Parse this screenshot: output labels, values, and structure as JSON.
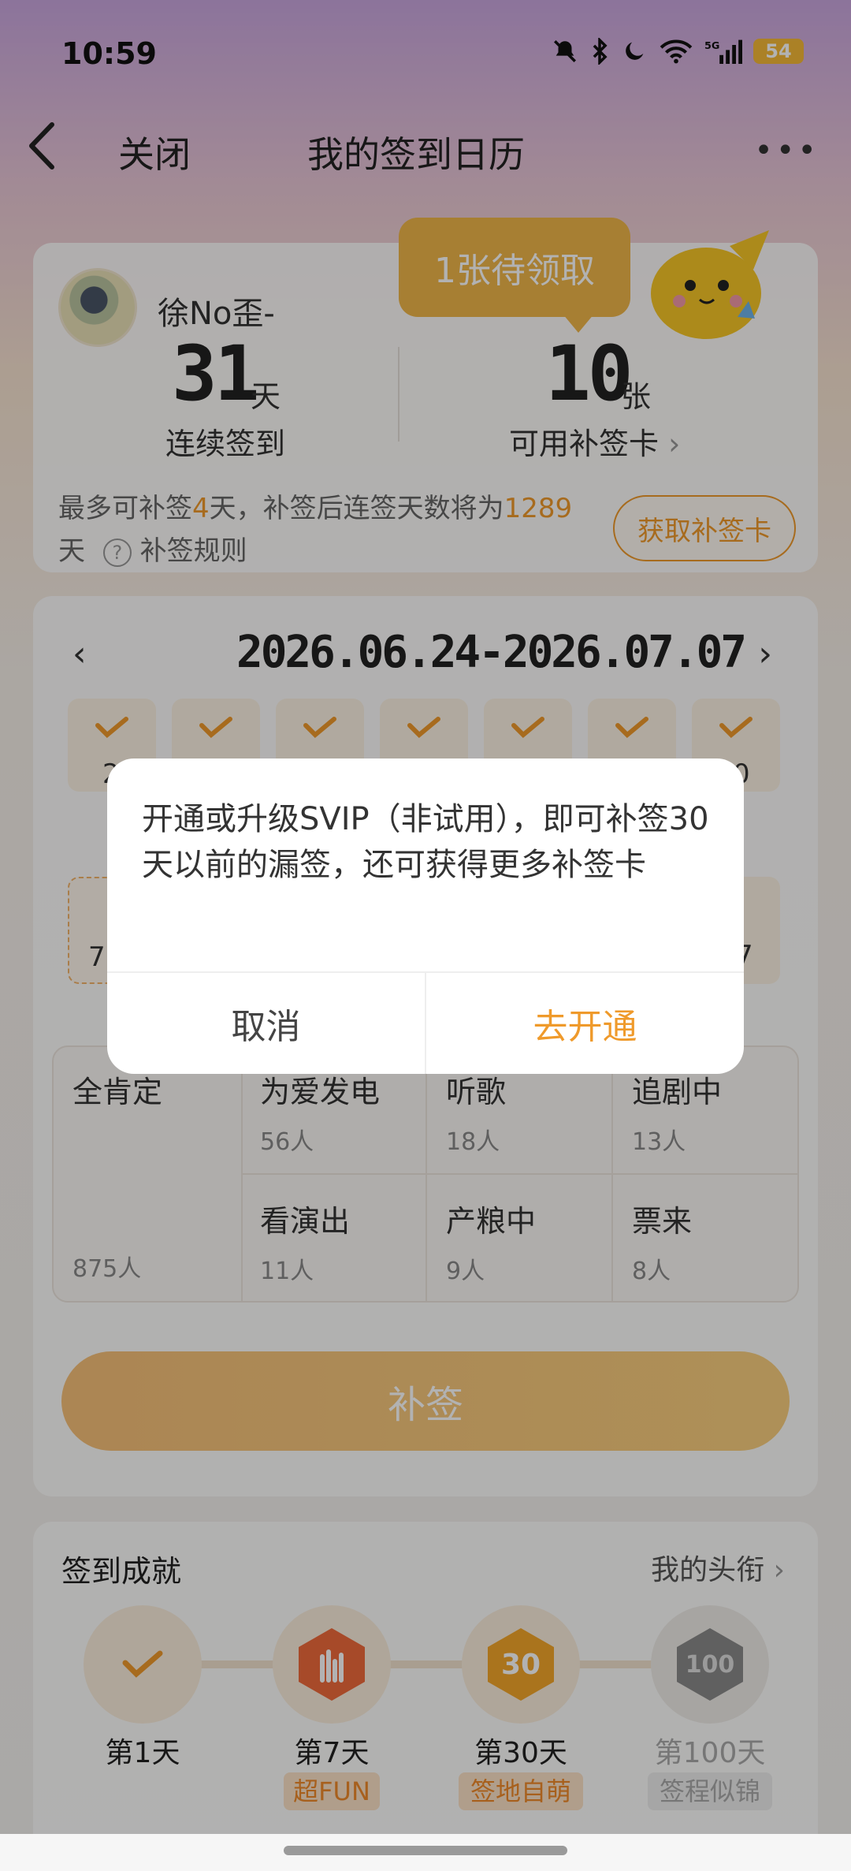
{
  "status": {
    "time": "10:59",
    "battery": "54",
    "network": "5G"
  },
  "nav": {
    "close": "关闭",
    "title": "我的签到日历",
    "more": "•••"
  },
  "summary": {
    "username": "徐No歪-",
    "bubble": "1张待领取",
    "streak_num": "31",
    "streak_unit": "天",
    "streak_label": "连续签到",
    "cards_num": "10",
    "cards_unit": "张",
    "cards_label": "可用补签卡",
    "tip_a": "最多可补签",
    "tip_days": "4",
    "tip_b": "天，补签后连签天数将为",
    "tip_total": "1289",
    "tip_c": "天",
    "rules": "补签规则",
    "get_card": "获取补签卡"
  },
  "calendar": {
    "range": "2026.06.24-2026.07.07",
    "row1_partial_first": "2",
    "row1_partial_last": "0",
    "row2_partial_first": "7",
    "row2_partial_last": "7"
  },
  "tags": [
    {
      "name": "全肯定",
      "count": "875人"
    },
    {
      "name": "为爱发电",
      "count": "56人"
    },
    {
      "name": "听歌",
      "count": "18人"
    },
    {
      "name": "追剧中",
      "count": "13人"
    },
    {
      "name": "看演出",
      "count": "11人"
    },
    {
      "name": "产粮中",
      "count": "9人"
    },
    {
      "name": "票来",
      "count": "8人"
    }
  ],
  "buqian_button": "补签",
  "achievements": {
    "title": "签到成就",
    "link": "我的头衔",
    "items": [
      {
        "day": "第1天",
        "badge": ""
      },
      {
        "day": "第7天",
        "badge": "超FUN"
      },
      {
        "day": "第30天",
        "badge": "签地自萌"
      },
      {
        "day": "第100天",
        "badge": "签程似锦"
      }
    ]
  },
  "dialog": {
    "message": "开通或升级SVIP（非试用），即可补签30天以前的漏签，还可获得更多补签卡",
    "cancel": "取消",
    "confirm": "去开通"
  },
  "colors": {
    "accent": "#ef9a2b",
    "bubble": "#f0b64a"
  }
}
